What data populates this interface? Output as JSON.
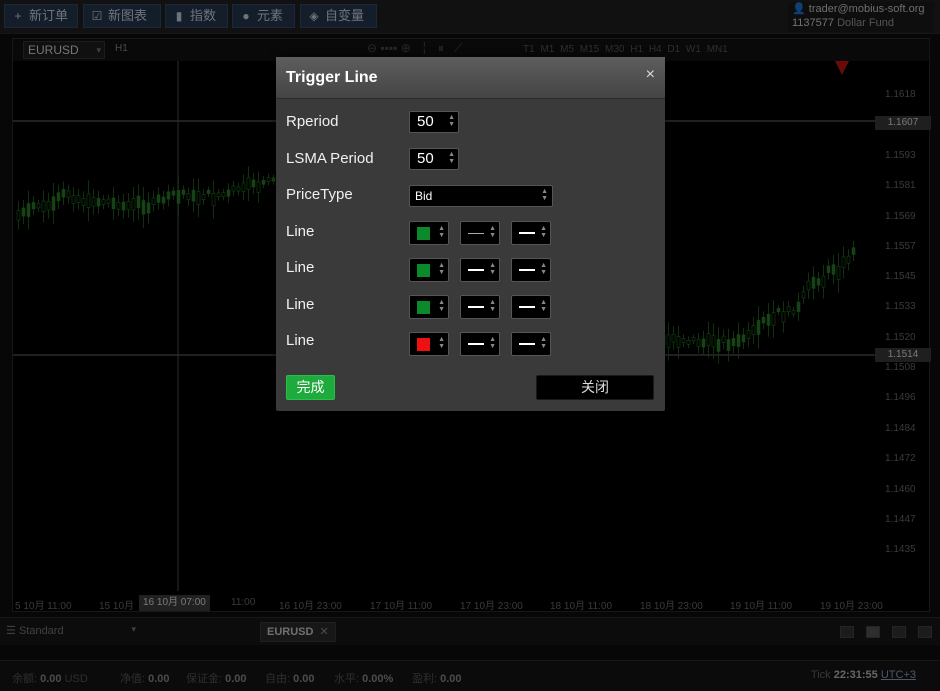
{
  "toolbar": {
    "buttons": [
      {
        "icon": "+",
        "label": "新订单"
      },
      {
        "icon": "☑",
        "label": "新图表"
      },
      {
        "icon": "▮",
        "label": "指数"
      },
      {
        "icon": "●",
        "label": "元素"
      },
      {
        "icon": "◈",
        "label": "自变量"
      }
    ]
  },
  "account": {
    "email": "trader@mobius-soft.org",
    "number": "1137577",
    "fund": "Dollar Fund"
  },
  "chart": {
    "symbol": "EURUSD",
    "timeframe": "H1",
    "timeframes": "T1 M1 M5 M15 M30 H1 H4 D1 W1 MN1",
    "price_ticks": [
      "1.1618",
      "1.1593",
      "1.1581",
      "1.1569",
      "1.1557",
      "1.1545",
      "1.1533",
      "1.1520",
      "1.1508",
      "1.1496",
      "1.1484",
      "1.1472",
      "1.1460",
      "1.1447",
      "1.1435"
    ],
    "price_badge_top": "1.1607",
    "price_badge_bottom": "1.1514",
    "time_ticks": [
      "5 10月 11:00",
      "15 10月",
      "11:00",
      "16 10月 23:00",
      "17 10月 11:00",
      "17 10月 23:00",
      "18 10月 11:00",
      "18 10月 23:00",
      "19 10月 11:00",
      "19 10月 23:00"
    ],
    "cursor_time": "16 10月 07:00"
  },
  "tabbar": {
    "layout": "Standard",
    "symbol_tab": "EURUSD"
  },
  "status": {
    "balance_label": "余额:",
    "balance": "0.00",
    "currency": "USD",
    "equity_label": "净值:",
    "equity": "0.00",
    "margin_label": "保证金:",
    "margin": "0.00",
    "free_label": "自由:",
    "free": "0.00",
    "level_label": "水平:",
    "level": "0.00%",
    "profit_label": "盈利:",
    "profit": "0.00",
    "tick_label": "Tick",
    "time": "22:31:55",
    "tz": "UTC+3"
  },
  "modal": {
    "title": "Trigger Line",
    "close_icon": "×",
    "rperiod_label": "Rperiod",
    "rperiod_value": "50",
    "lsma_label": "LSMA Period",
    "lsma_value": "50",
    "pricetype_label": "PriceType",
    "pricetype_value": "Bid",
    "lines": [
      {
        "label": "Line",
        "color": "#0a8a2a"
      },
      {
        "label": "Line",
        "color": "#0a8a2a"
      },
      {
        "label": "Line",
        "color": "#0a8a2a"
      },
      {
        "label": "Line",
        "color": "#ee1111"
      }
    ],
    "ok_label": "完成",
    "close_label": "关闭"
  }
}
